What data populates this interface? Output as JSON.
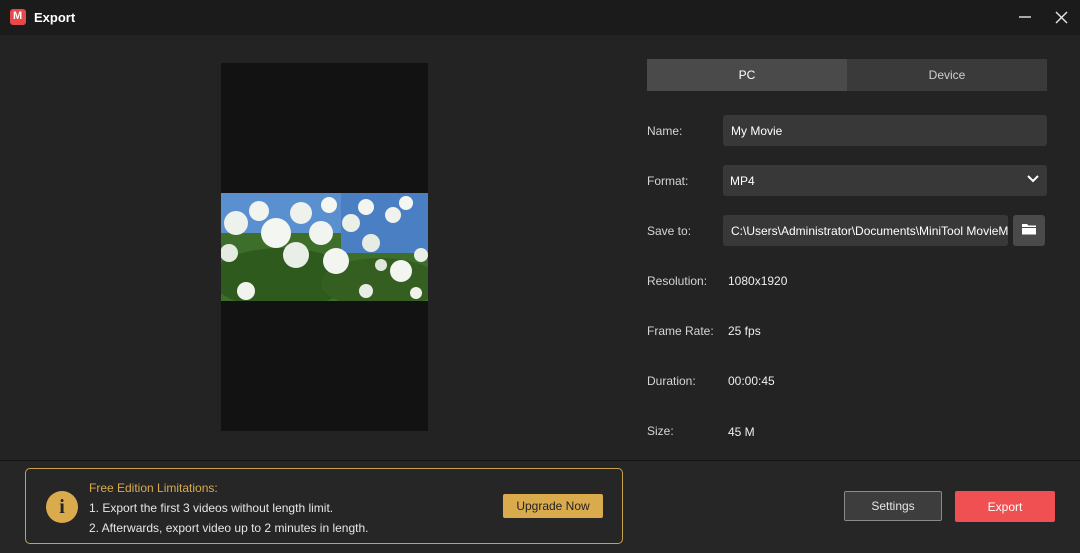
{
  "window": {
    "title": "Export",
    "logo_letter": "M",
    "minimize_icon": "minimize-icon",
    "close_icon": "close-icon"
  },
  "tabs": [
    {
      "label": "PC",
      "active": true
    },
    {
      "label": "Device",
      "active": false
    }
  ],
  "form": {
    "name_label": "Name:",
    "name_value": "My Movie",
    "format_label": "Format:",
    "format_value": "MP4",
    "save_to_label": "Save to:",
    "save_to_value": "C:\\Users\\Administrator\\Documents\\MiniTool MovieMaker\\output",
    "resolution_label": "Resolution:",
    "resolution_value": "1080x1920",
    "frame_rate_label": "Frame Rate:",
    "frame_rate_value": "25 fps",
    "duration_label": "Duration:",
    "duration_value": "00:00:45",
    "size_label": "Size:",
    "size_value": "45 M"
  },
  "limitations": {
    "title": "Free Edition Limitations:",
    "line1": "1. Export the first 3 videos without length limit.",
    "line2": "2. Afterwards, export video up to 2 minutes in length.",
    "upgrade_label": "Upgrade Now"
  },
  "actions": {
    "settings_label": "Settings",
    "export_label": "Export"
  },
  "colors": {
    "accent_export": "#f05052",
    "accent_gold": "#d9ab4d",
    "background": "#232323"
  }
}
